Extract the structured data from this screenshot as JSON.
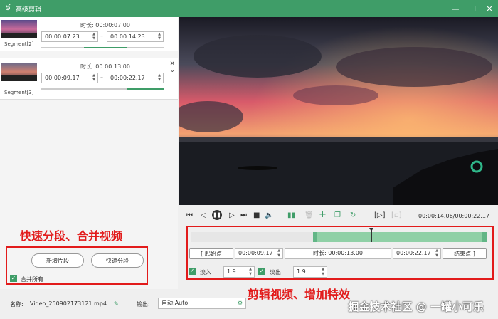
{
  "app": {
    "title": "高级剪辑"
  },
  "segments": [
    {
      "label": "Segment[2]",
      "duration_label": "时长:",
      "duration": "00:00:07.00",
      "start": "00:00:07.23",
      "end": "00:00:14.23"
    },
    {
      "label": "Segment[3]",
      "duration_label": "时长:",
      "duration": "00:00:13.00",
      "start": "00:00:09.17",
      "end": "00:00:22.17"
    }
  ],
  "left_actions": {
    "add_segment": "新增片段",
    "quick_split": "快速分段",
    "merge_all": "合并所有",
    "annotation": "快速分段、合并视频"
  },
  "player": {
    "time_readout": "00:00:14.06/00:00:22.17"
  },
  "edit": {
    "start_btn": "[ 起始点",
    "start_time": "00:00:09.17",
    "duration_label": "时长:",
    "duration": "00:00:13.00",
    "end_time": "00:00:22.17",
    "end_btn": "结束点 ]",
    "fade_in_label": "淡入",
    "fade_in_value": "1.9",
    "fade_out_label": "淡出",
    "fade_out_value": "1.9",
    "annotation": "剪辑视频、增加特效"
  },
  "bottom": {
    "name_label": "名称:",
    "name_value": "Video_250902173121.mp4",
    "output_label": "输出:",
    "output_value": "自动:Auto",
    "watermark": "掘金技术社区 @ 一罐小可乐"
  },
  "colors": {
    "accent": "#3f9d68",
    "annotation": "#e21b1b"
  }
}
